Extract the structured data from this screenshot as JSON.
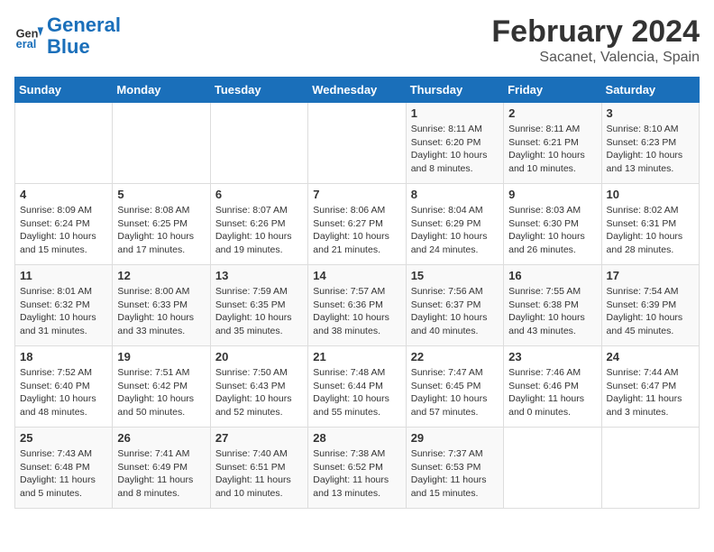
{
  "header": {
    "logo_general": "General",
    "logo_blue": "Blue",
    "title": "February 2024",
    "subtitle": "Sacanet, Valencia, Spain"
  },
  "days_of_week": [
    "Sunday",
    "Monday",
    "Tuesday",
    "Wednesday",
    "Thursday",
    "Friday",
    "Saturday"
  ],
  "weeks": [
    [
      {
        "day": "",
        "info": ""
      },
      {
        "day": "",
        "info": ""
      },
      {
        "day": "",
        "info": ""
      },
      {
        "day": "",
        "info": ""
      },
      {
        "day": "1",
        "info": "Sunrise: 8:11 AM\nSunset: 6:20 PM\nDaylight: 10 hours\nand 8 minutes."
      },
      {
        "day": "2",
        "info": "Sunrise: 8:11 AM\nSunset: 6:21 PM\nDaylight: 10 hours\nand 10 minutes."
      },
      {
        "day": "3",
        "info": "Sunrise: 8:10 AM\nSunset: 6:23 PM\nDaylight: 10 hours\nand 13 minutes."
      }
    ],
    [
      {
        "day": "4",
        "info": "Sunrise: 8:09 AM\nSunset: 6:24 PM\nDaylight: 10 hours\nand 15 minutes."
      },
      {
        "day": "5",
        "info": "Sunrise: 8:08 AM\nSunset: 6:25 PM\nDaylight: 10 hours\nand 17 minutes."
      },
      {
        "day": "6",
        "info": "Sunrise: 8:07 AM\nSunset: 6:26 PM\nDaylight: 10 hours\nand 19 minutes."
      },
      {
        "day": "7",
        "info": "Sunrise: 8:06 AM\nSunset: 6:27 PM\nDaylight: 10 hours\nand 21 minutes."
      },
      {
        "day": "8",
        "info": "Sunrise: 8:04 AM\nSunset: 6:29 PM\nDaylight: 10 hours\nand 24 minutes."
      },
      {
        "day": "9",
        "info": "Sunrise: 8:03 AM\nSunset: 6:30 PM\nDaylight: 10 hours\nand 26 minutes."
      },
      {
        "day": "10",
        "info": "Sunrise: 8:02 AM\nSunset: 6:31 PM\nDaylight: 10 hours\nand 28 minutes."
      }
    ],
    [
      {
        "day": "11",
        "info": "Sunrise: 8:01 AM\nSunset: 6:32 PM\nDaylight: 10 hours\nand 31 minutes."
      },
      {
        "day": "12",
        "info": "Sunrise: 8:00 AM\nSunset: 6:33 PM\nDaylight: 10 hours\nand 33 minutes."
      },
      {
        "day": "13",
        "info": "Sunrise: 7:59 AM\nSunset: 6:35 PM\nDaylight: 10 hours\nand 35 minutes."
      },
      {
        "day": "14",
        "info": "Sunrise: 7:57 AM\nSunset: 6:36 PM\nDaylight: 10 hours\nand 38 minutes."
      },
      {
        "day": "15",
        "info": "Sunrise: 7:56 AM\nSunset: 6:37 PM\nDaylight: 10 hours\nand 40 minutes."
      },
      {
        "day": "16",
        "info": "Sunrise: 7:55 AM\nSunset: 6:38 PM\nDaylight: 10 hours\nand 43 minutes."
      },
      {
        "day": "17",
        "info": "Sunrise: 7:54 AM\nSunset: 6:39 PM\nDaylight: 10 hours\nand 45 minutes."
      }
    ],
    [
      {
        "day": "18",
        "info": "Sunrise: 7:52 AM\nSunset: 6:40 PM\nDaylight: 10 hours\nand 48 minutes."
      },
      {
        "day": "19",
        "info": "Sunrise: 7:51 AM\nSunset: 6:42 PM\nDaylight: 10 hours\nand 50 minutes."
      },
      {
        "day": "20",
        "info": "Sunrise: 7:50 AM\nSunset: 6:43 PM\nDaylight: 10 hours\nand 52 minutes."
      },
      {
        "day": "21",
        "info": "Sunrise: 7:48 AM\nSunset: 6:44 PM\nDaylight: 10 hours\nand 55 minutes."
      },
      {
        "day": "22",
        "info": "Sunrise: 7:47 AM\nSunset: 6:45 PM\nDaylight: 10 hours\nand 57 minutes."
      },
      {
        "day": "23",
        "info": "Sunrise: 7:46 AM\nSunset: 6:46 PM\nDaylight: 11 hours\nand 0 minutes."
      },
      {
        "day": "24",
        "info": "Sunrise: 7:44 AM\nSunset: 6:47 PM\nDaylight: 11 hours\nand 3 minutes."
      }
    ],
    [
      {
        "day": "25",
        "info": "Sunrise: 7:43 AM\nSunset: 6:48 PM\nDaylight: 11 hours\nand 5 minutes."
      },
      {
        "day": "26",
        "info": "Sunrise: 7:41 AM\nSunset: 6:49 PM\nDaylight: 11 hours\nand 8 minutes."
      },
      {
        "day": "27",
        "info": "Sunrise: 7:40 AM\nSunset: 6:51 PM\nDaylight: 11 hours\nand 10 minutes."
      },
      {
        "day": "28",
        "info": "Sunrise: 7:38 AM\nSunset: 6:52 PM\nDaylight: 11 hours\nand 13 minutes."
      },
      {
        "day": "29",
        "info": "Sunrise: 7:37 AM\nSunset: 6:53 PM\nDaylight: 11 hours\nand 15 minutes."
      },
      {
        "day": "",
        "info": ""
      },
      {
        "day": "",
        "info": ""
      }
    ]
  ]
}
